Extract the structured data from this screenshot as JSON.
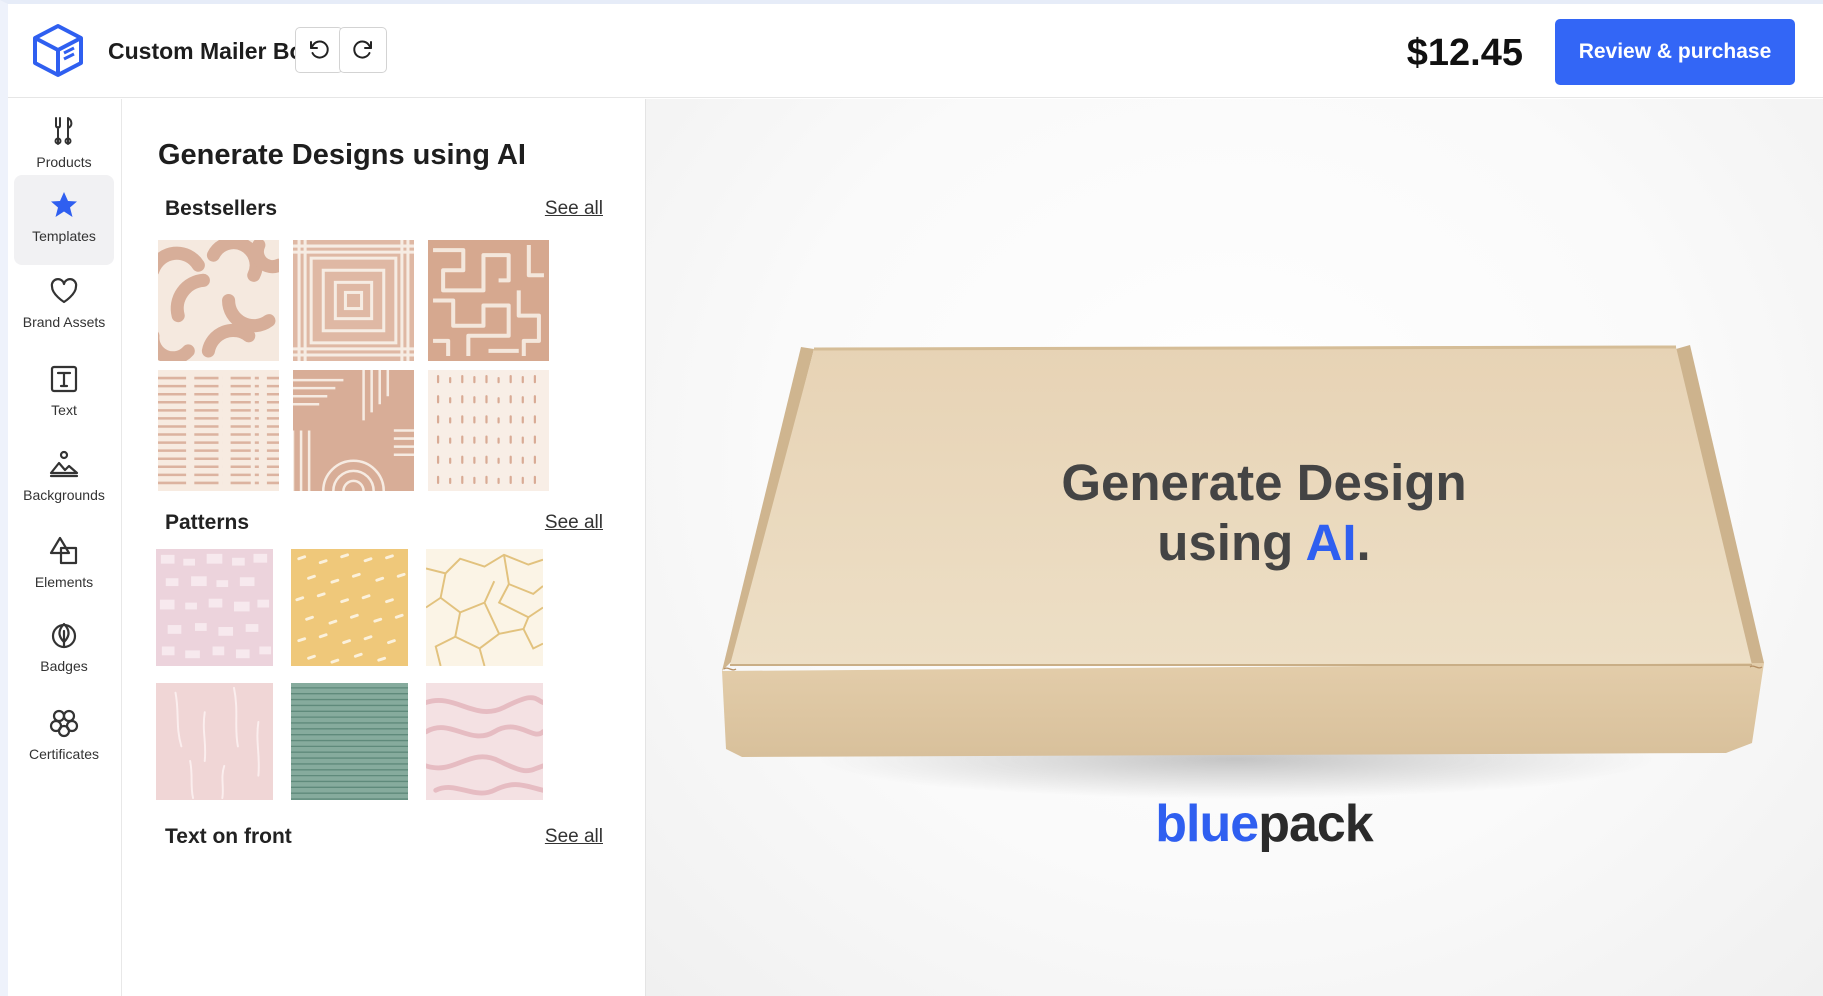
{
  "header": {
    "title": "Custom Mailer Box",
    "price": "$12.45",
    "cta_label": "Review & purchase",
    "undo_icon": "undo-icon",
    "redo_icon": "redo-icon",
    "logo_icon": "cube-icon"
  },
  "rail": {
    "items": [
      {
        "label": "Products",
        "icon": "tools-icon"
      },
      {
        "label": "Templates",
        "icon": "star-icon",
        "active": true
      },
      {
        "label": "Brand Assets",
        "icon": "heart-icon"
      },
      {
        "label": "Text",
        "icon": "text-icon"
      },
      {
        "label": "Backgrounds",
        "icon": "landscape-icon"
      },
      {
        "label": "Elements",
        "icon": "shapes-icon"
      },
      {
        "label": "Badges",
        "icon": "leaf-badge-icon"
      },
      {
        "label": "Certificates",
        "icon": "certificate-icon"
      }
    ]
  },
  "panel": {
    "title": "Generate Designs using AI",
    "sections": [
      {
        "title": "Bestsellers",
        "see_all": "See all"
      },
      {
        "title": "Patterns",
        "see_all": "See all"
      },
      {
        "title": "Text on front",
        "see_all": "See all"
      }
    ]
  },
  "preview": {
    "headline_line1": "Generate Design",
    "headline_line2_prefix": "using ",
    "headline_highlight": "AI",
    "headline_suffix": ".",
    "brand_part1": "blue",
    "brand_part2": "pack"
  },
  "colors": {
    "accent": "#3366f6",
    "box_tan": "#e9d8bb",
    "pattern_terracotta": "#d9b29d",
    "pattern_cream": "#f7ece2"
  }
}
